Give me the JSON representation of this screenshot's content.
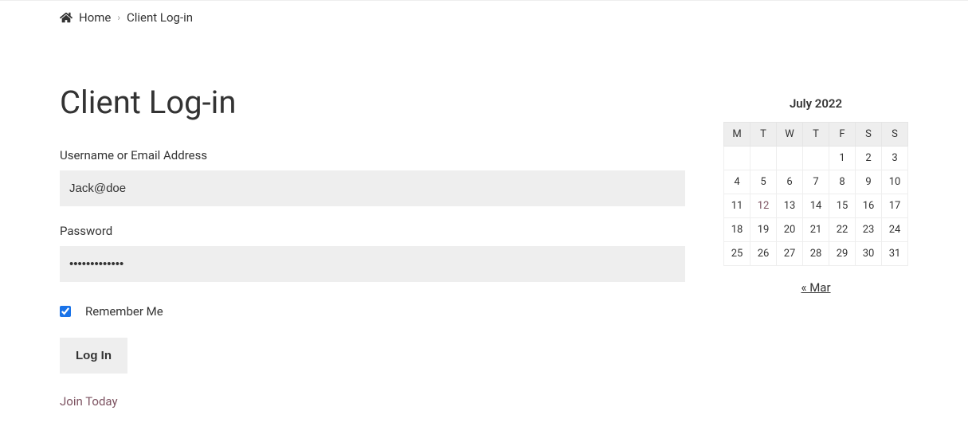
{
  "breadcrumb": {
    "home_label": "Home",
    "current": "Client Log-in"
  },
  "page": {
    "title": "Client Log-in"
  },
  "form": {
    "username_label": "Username or Email Address",
    "username_value": "Jack@doe",
    "password_label": "Password",
    "password_value": "•••••••••••••",
    "remember_label": "Remember Me",
    "submit_label": "Log In"
  },
  "links": {
    "join_label": "Join Today"
  },
  "calendar": {
    "title": "July 2022",
    "dow": [
      "M",
      "T",
      "W",
      "T",
      "F",
      "S",
      "S"
    ],
    "weeks": [
      [
        "",
        "",
        "",
        "",
        "1",
        "2",
        "3"
      ],
      [
        "4",
        "5",
        "6",
        "7",
        "8",
        "9",
        "10"
      ],
      [
        "11",
        "12",
        "13",
        "14",
        "15",
        "16",
        "17"
      ],
      [
        "18",
        "19",
        "20",
        "21",
        "22",
        "23",
        "24"
      ],
      [
        "25",
        "26",
        "27",
        "28",
        "29",
        "30",
        "31"
      ]
    ],
    "linked_day": "12",
    "prev_label": "« Mar"
  }
}
